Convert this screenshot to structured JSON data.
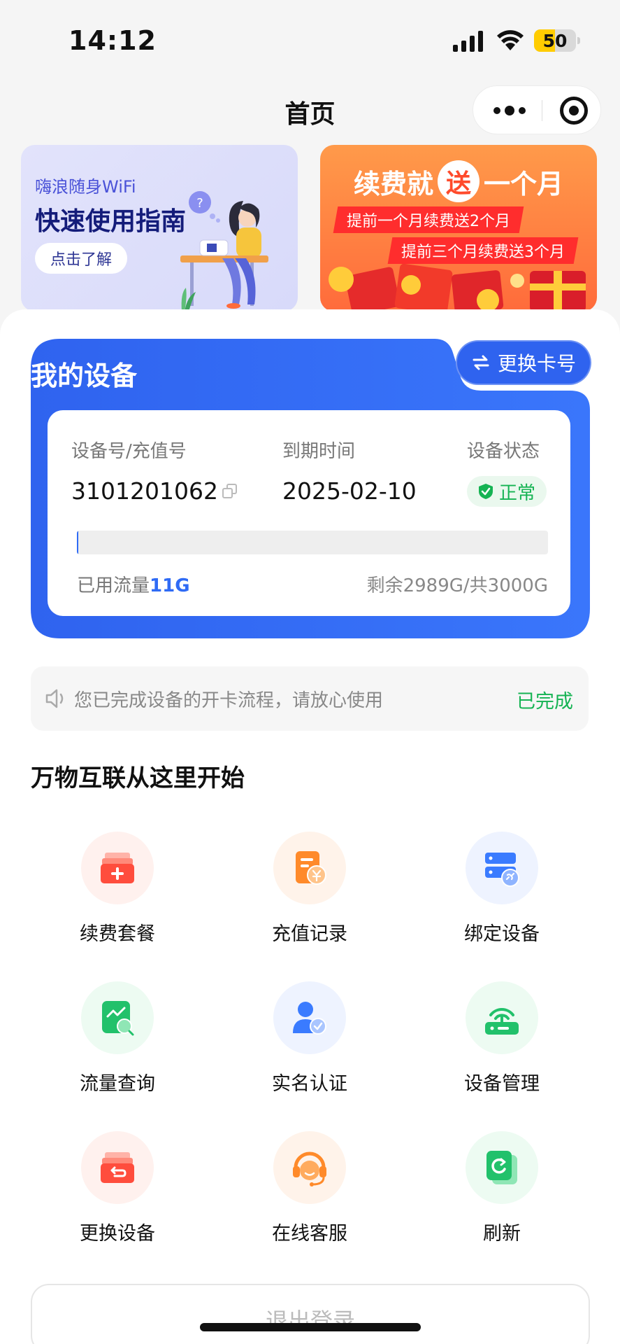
{
  "status_bar": {
    "time": "14:12",
    "battery_level": "50",
    "battery_fraction": 0.5,
    "icons": [
      "signal-icon",
      "wifi-icon",
      "battery-icon"
    ]
  },
  "nav": {
    "title": "首页",
    "menu_icon": "more-dots-icon",
    "close_icon": "target-icon"
  },
  "banners": {
    "guide": {
      "brand": "嗨浪随身WiFi",
      "title": "快速使用指南",
      "button": "点击了解"
    },
    "renew": {
      "title_before": "续费就",
      "title_badge": "送",
      "title_after": "一个月",
      "ribbon_1": "提前一个月续费送2个月",
      "ribbon_2": "提前三个月续费送3个月"
    }
  },
  "device": {
    "title": "我的设备",
    "switch_button": "更换卡号",
    "labels": {
      "id": "设备号/充值号",
      "expiry": "到期时间",
      "status": "设备状态"
    },
    "device_id": "3101201062",
    "expiry_date": "2025-02-10",
    "status": "正常",
    "used_label": "已用流量",
    "used_value": "11G",
    "remaining": "剩余2989G/共3000G",
    "usage_fraction": 0.0037,
    "colors": {
      "primary": "#2f6bf5",
      "status_green": "#15b353"
    }
  },
  "notice": {
    "text": "您已完成设备的开卡流程，请放心使用",
    "status": "已完成"
  },
  "section": {
    "title": "万物互联从这里开始"
  },
  "grid": [
    {
      "label": "续费套餐",
      "icon": "renew-package-icon"
    },
    {
      "label": "充值记录",
      "icon": "recharge-record-icon"
    },
    {
      "label": "绑定设备",
      "icon": "bind-device-icon"
    },
    {
      "label": "流量查询",
      "icon": "traffic-query-icon"
    },
    {
      "label": "实名认证",
      "icon": "real-name-icon"
    },
    {
      "label": "设备管理",
      "icon": "router-icon"
    },
    {
      "label": "更换设备",
      "icon": "replace-device-icon"
    },
    {
      "label": "在线客服",
      "icon": "customer-service-icon"
    },
    {
      "label": "刷新",
      "icon": "refresh-icon"
    }
  ],
  "logout": {
    "label": "退出登录"
  }
}
